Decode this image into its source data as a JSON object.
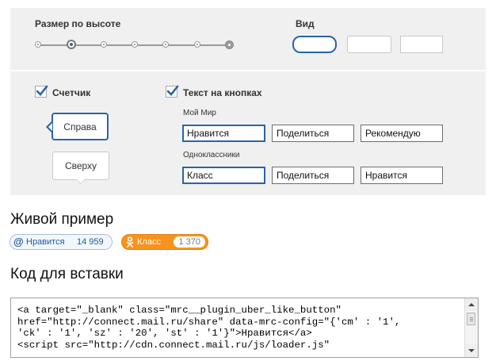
{
  "size": {
    "label": "Размер по высоте",
    "levels": 7,
    "selected_level": 2
  },
  "view": {
    "label": "Вид",
    "options": [
      "rounded",
      "square-rounded",
      "square"
    ],
    "selected": "rounded"
  },
  "counter": {
    "label": "Счетчик",
    "checked": true,
    "positions": [
      "Справа",
      "Сверху"
    ],
    "selected_position": "Справа"
  },
  "button_text": {
    "label": "Текст на кнопках",
    "checked": true,
    "moi_mir": {
      "label": "Мой Мир",
      "options": [
        "Нравится",
        "Поделиться",
        "Рекомендую"
      ],
      "selected": "Нравится"
    },
    "odnoklassniki": {
      "label": "Одноклассники",
      "options": [
        "Класс",
        "Поделиться",
        "Нравится"
      ],
      "selected": "Класс"
    }
  },
  "live_example": {
    "title": "Живой пример",
    "mail_button": {
      "icon": "@",
      "label": "Нравится",
      "count": "14 959"
    },
    "ok_button": {
      "icon": "odnoklassniki-icon",
      "label": "Класс",
      "count": "1 370"
    }
  },
  "embed_code": {
    "title": "Код для вставки",
    "code": "<a target=\"_blank\" class=\"mrc__plugin_uber_like_button\"\nhref=\"http://connect.mail.ru/share\" data-mrc-config=\"{'cm' : '1',\n'ck' : '1', 'sz' : '20', 'st' : '1'}\">Нравится</a>\n<script src=\"http://cdn.connect.mail.ru/js/loader.js\""
  },
  "colors": {
    "accent": "#2b63a6",
    "panel_bg": "#f0f0f0",
    "ok_orange": "#f7931e"
  }
}
